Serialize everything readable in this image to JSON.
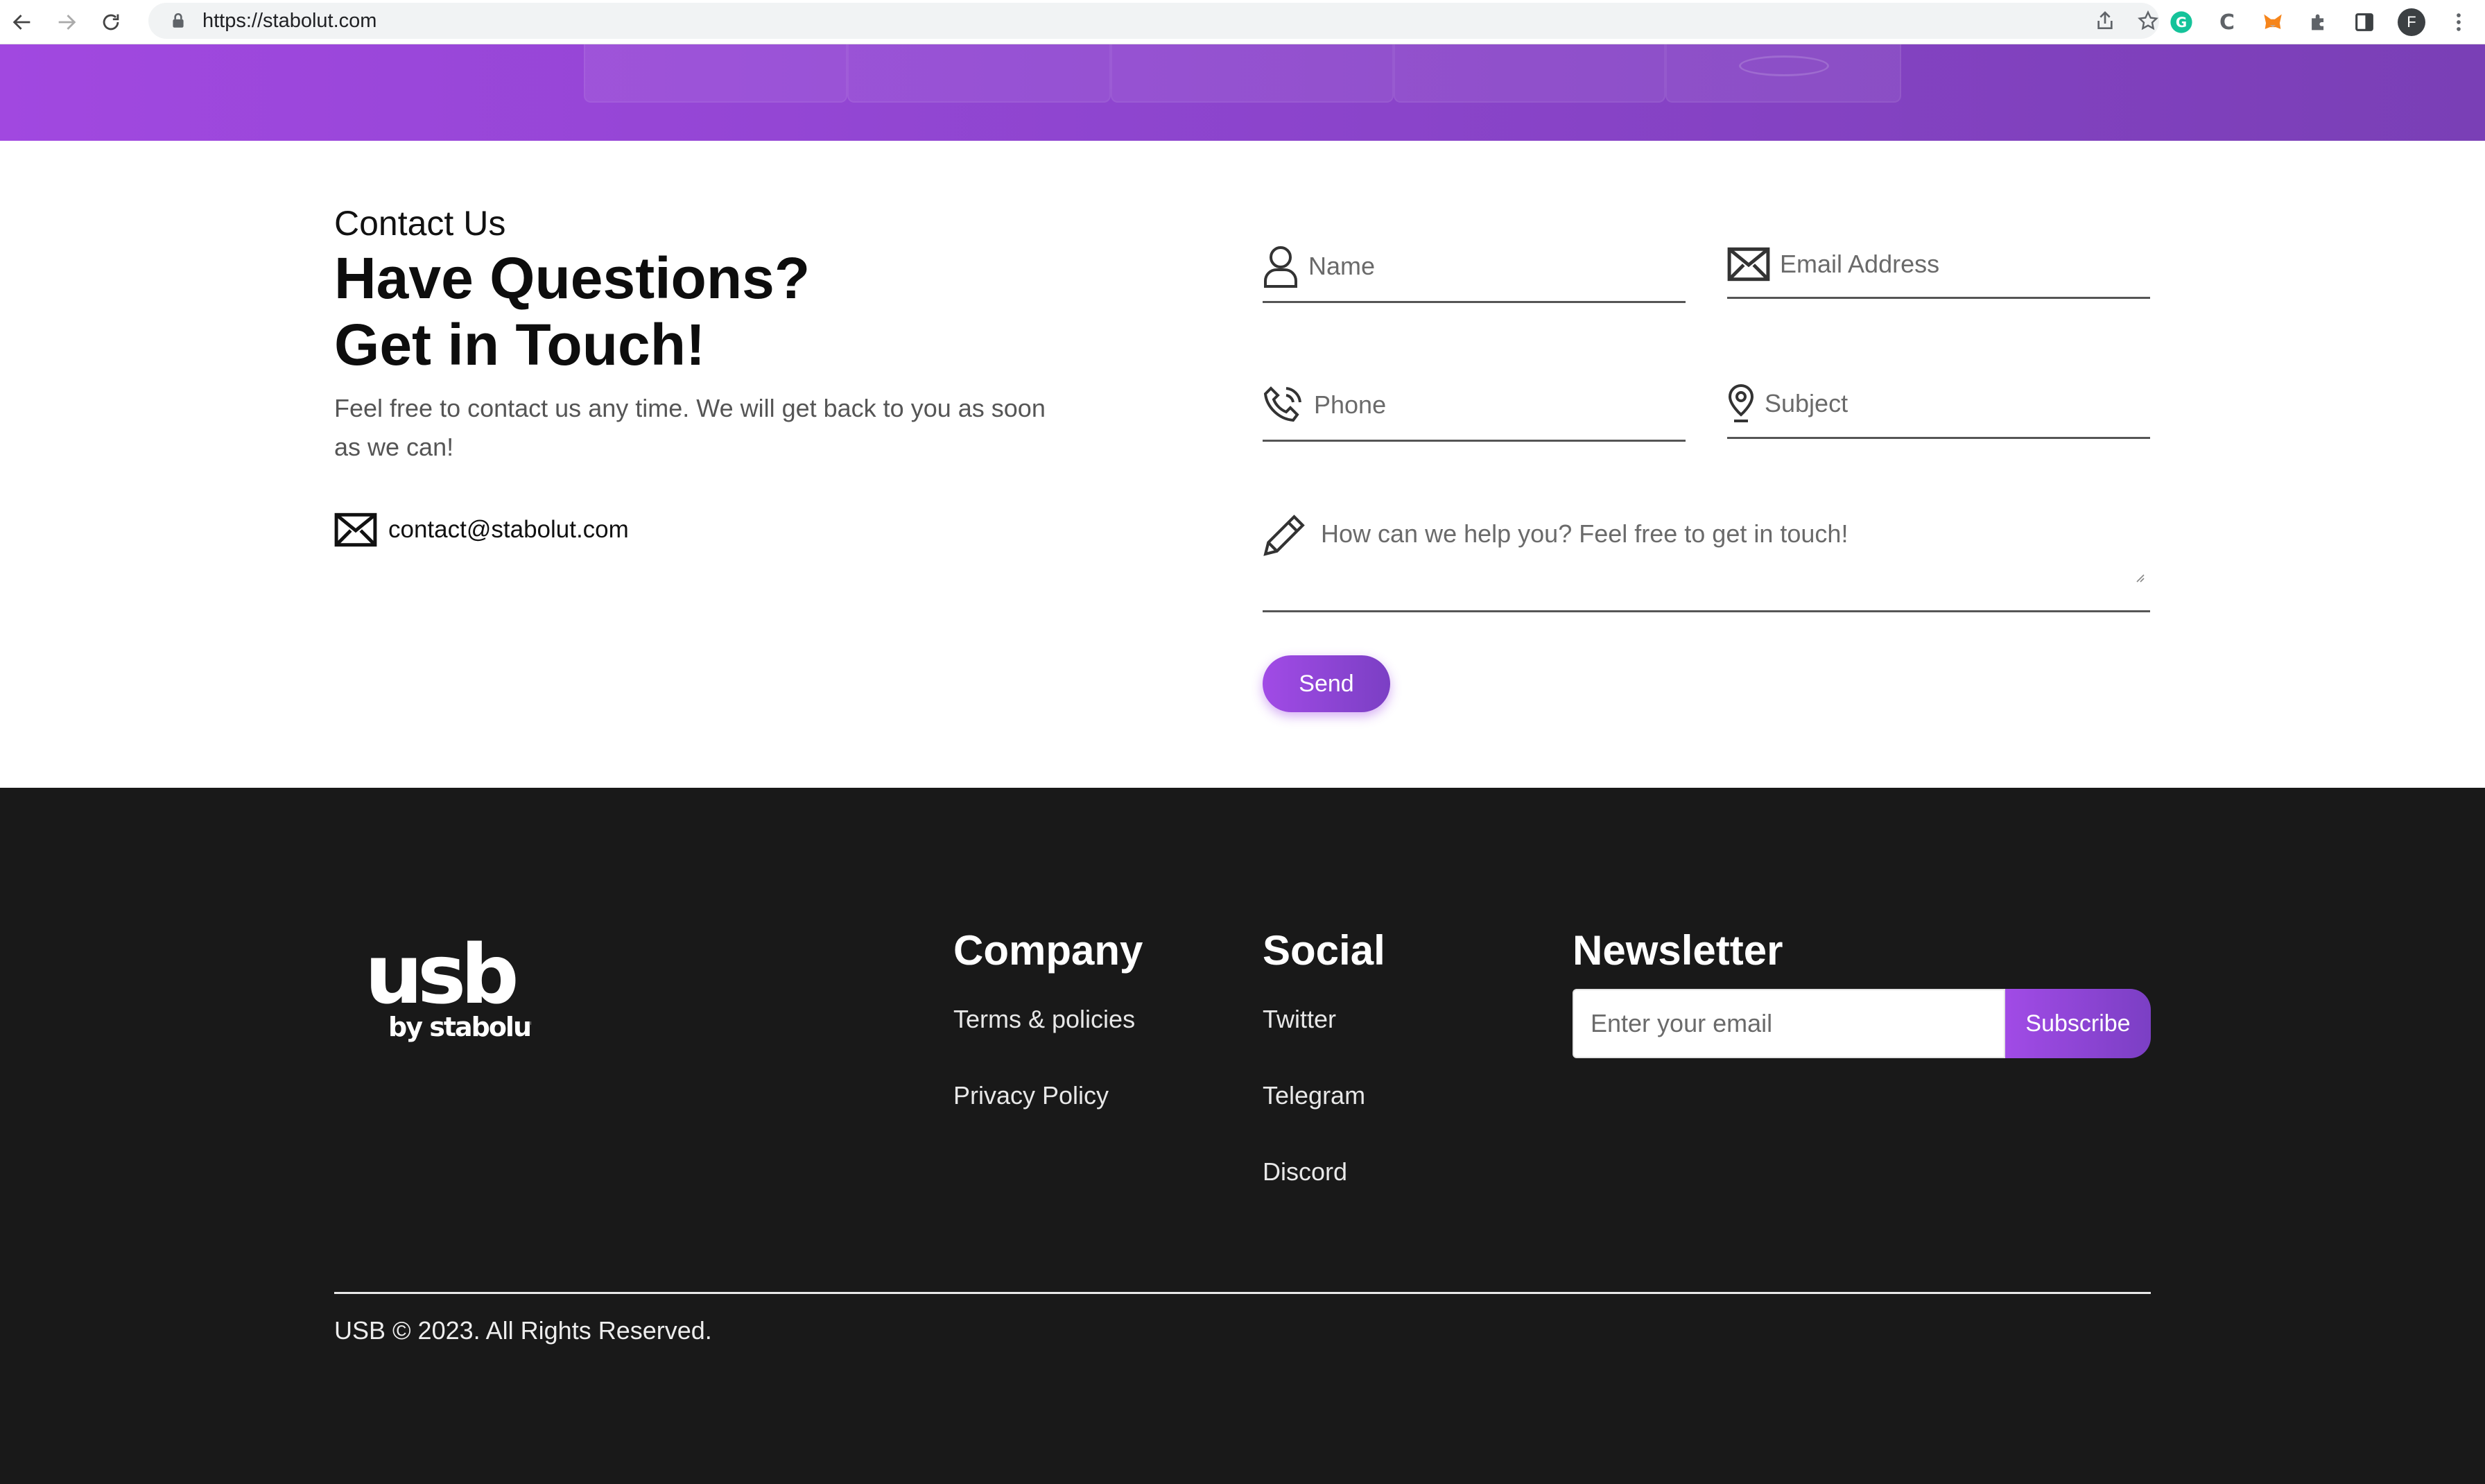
{
  "browser": {
    "url": "https://stabolut.com",
    "avatar_initial": "F"
  },
  "contact": {
    "eyebrow": "Contact Us",
    "headline_line1": "Have Questions?",
    "headline_line2": "Get in Touch!",
    "lead": "Feel free to contact us any time. We will get back to you as soon as we can!",
    "email": "contact@stabolut.com",
    "form": {
      "name_placeholder": "Name",
      "email_placeholder": "Email Address",
      "phone_placeholder": "Phone",
      "subject_placeholder": "Subject",
      "message_placeholder": "How can we help you? Feel free to get in touch!",
      "send_label": "Send"
    }
  },
  "footer": {
    "logo_text": "usb",
    "logo_subtext": "by stabolut",
    "company": {
      "title": "Company",
      "links": [
        "Terms & policies",
        "Privacy Policy"
      ]
    },
    "social": {
      "title": "Social",
      "links": [
        "Twitter",
        "Telegram",
        "Discord"
      ]
    },
    "newsletter": {
      "title": "Newsletter",
      "placeholder": "Enter your email",
      "button_label": "Subscribe"
    },
    "copyright": "USB © 2023. All Rights Reserved."
  },
  "colors": {
    "accent": "#9a48dc",
    "footer_bg": "#191919",
    "hero_gradient_start": "#a148e0",
    "hero_gradient_end": "#7a3fb6"
  }
}
